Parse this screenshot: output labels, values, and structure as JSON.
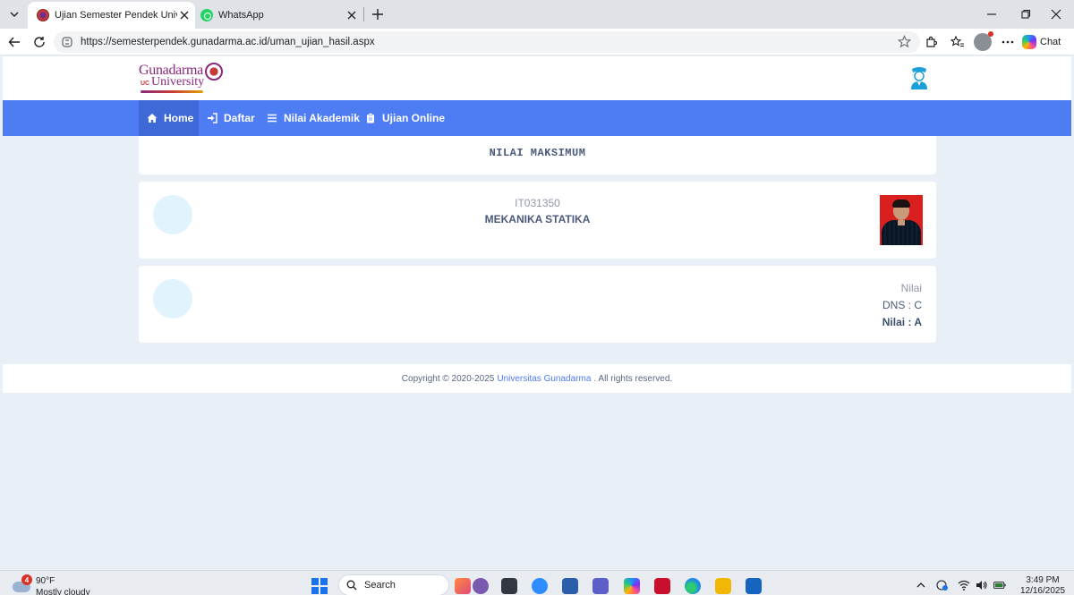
{
  "browser": {
    "tabs": [
      {
        "title": "Ujian Semester Pendek Universitas"
      },
      {
        "title": "WhatsApp"
      }
    ],
    "url": "https://semesterpendek.gunadarma.ac.id/uman_ujian_hasil.aspx",
    "chat_label": "Chat"
  },
  "site": {
    "logo": {
      "line1": "Gunadarma",
      "line2": "University",
      "uc": "UC"
    },
    "nav": [
      {
        "label": "Home",
        "icon": "home-icon",
        "active": true
      },
      {
        "label": "Daftar",
        "icon": "sign-in-icon"
      },
      {
        "label": "Nilai Akademik",
        "icon": "list-icon"
      },
      {
        "label": "Ujian Online",
        "icon": "clipboard-icon"
      }
    ]
  },
  "main": {
    "title": "NILAI MAKSIMUM",
    "course": {
      "code": "IT031350",
      "name": "MEKANIKA STATIKA"
    },
    "result": {
      "label": "Nilai",
      "dns": "DNS : C",
      "grade": "Nilai : A"
    }
  },
  "footer": {
    "prefix": "Copyright © 2020-2025",
    "link": "Universitas Gunadarma",
    "suffix": ". All rights reserved."
  },
  "taskbar": {
    "weather": {
      "temp": "90°F",
      "condition": "Mostly cloudy",
      "badge": "4"
    },
    "search_placeholder": "Search",
    "time": "3:49 PM",
    "date": "12/16/2025"
  },
  "colors": {
    "nav_bg": "#4e7cf3",
    "nav_active": "#3f69d6",
    "page_bg": "#e9eff7"
  }
}
